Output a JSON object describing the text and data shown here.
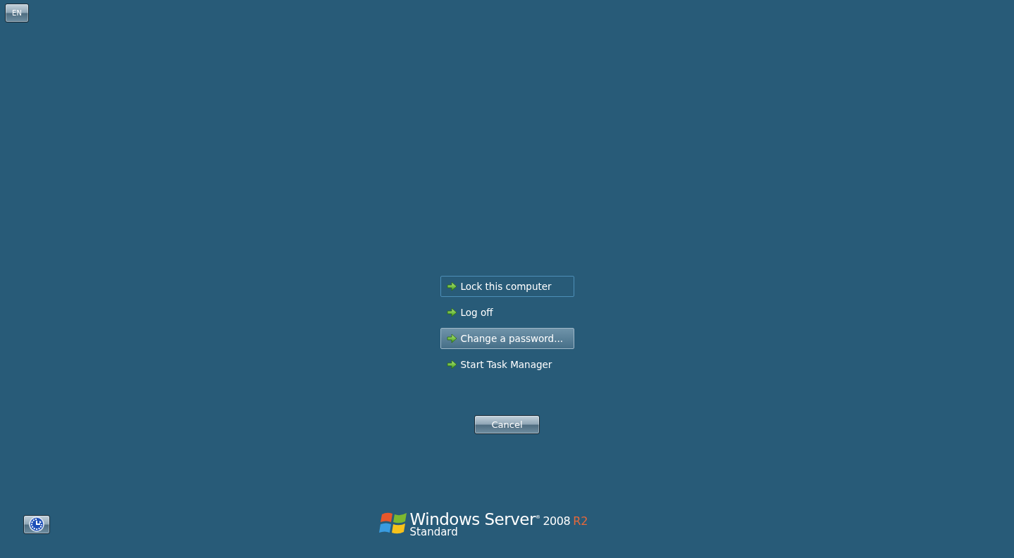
{
  "language_button": {
    "label": "EN"
  },
  "options": [
    {
      "label": "Lock this computer",
      "focused": true,
      "selected": false
    },
    {
      "label": "Log off",
      "focused": false,
      "selected": false
    },
    {
      "label": "Change a password...",
      "focused": false,
      "selected": true
    },
    {
      "label": "Start Task Manager",
      "focused": false,
      "selected": false
    }
  ],
  "cancel_button": {
    "label": "Cancel"
  },
  "branding": {
    "product": "Windows Server$^{®}$",
    "version": "2008",
    "release": "R2",
    "edition": "Standard"
  }
}
